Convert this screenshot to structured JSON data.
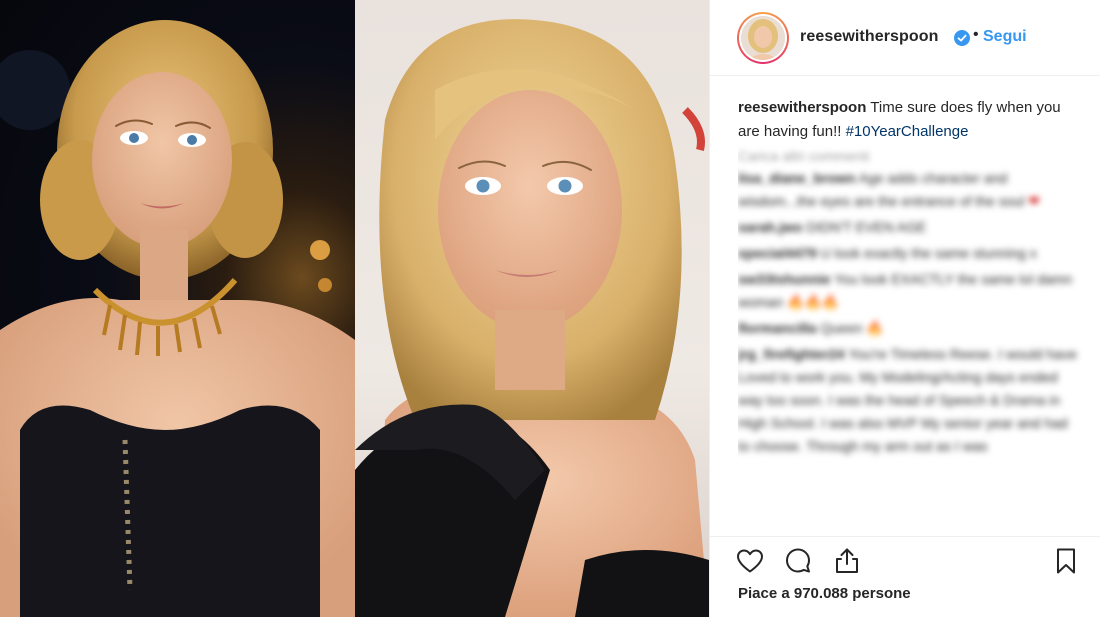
{
  "post": {
    "username": "reesewitherspoon",
    "separator": "•",
    "follow_label": "Segui",
    "caption": {
      "username": "reesewitherspoon",
      "text": "Time sure does fly when you are having fun!!",
      "hashtag": "#10YearChallenge"
    },
    "load_more_label": "Carica altri commenti",
    "comments": [
      {
        "user": "lisa_diane_brown",
        "text": "Age adds character and wisdom...the eyes are the entrance of the soul",
        "emoji": "❤"
      },
      {
        "user": "sarah.jwo",
        "text": "DIDN'T EVEN AGE",
        "emoji": ""
      },
      {
        "user": "special4479",
        "text": "U look exactly the same stunning x",
        "emoji": ""
      },
      {
        "user": "sw33tshunnie",
        "text": "You look EXACTLY the same lol damn woman",
        "emoji": "🔥🔥🔥"
      },
      {
        "user": "flormancilla",
        "text": "Queen",
        "emoji": "🔥"
      },
      {
        "user": "jrg_firefighter24",
        "text": "You're Timeless Reese. I would have Loved to work you. My Modeling/Acting days ended way too soon. I was the head of Speech & Drama in High School. I was also MVP My senior year and had to choose. Through my arm out as I was",
        "emoji": ""
      }
    ],
    "likes_label": "Piace a 970.088 persone"
  },
  "icons": {
    "like": "heart-outline-icon",
    "comment": "comment-bubble-icon",
    "share": "share-upload-icon",
    "save": "bookmark-icon",
    "verified": "verified-badge-icon"
  },
  "colors": {
    "link_blue": "#3897f0",
    "hashtag": "#003569",
    "text": "#262626",
    "border": "#efefef"
  }
}
